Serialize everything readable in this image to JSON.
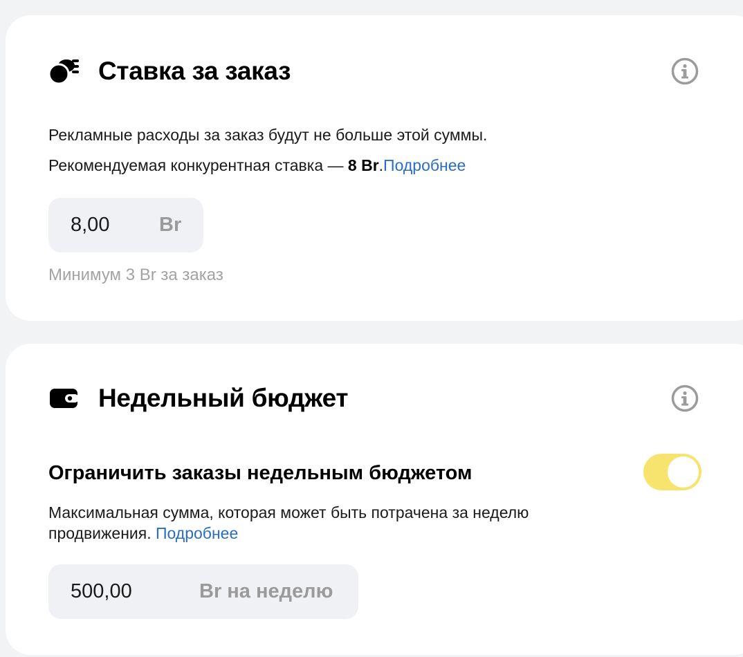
{
  "bid_card": {
    "icon": "coins-icon",
    "title": "Ставка за заказ",
    "info_icon": "info-icon",
    "description": "Рекламные расходы за заказ будут не больше этой суммы.",
    "recommended_prefix": "Рекомендуемая конкурентная ставка — ",
    "recommended_value": "8 Br",
    "recommended_suffix": ".",
    "more_link": "Подробнее",
    "input_value": "8,00",
    "input_unit": "Br",
    "hint": "Минимум 3 Br за заказ"
  },
  "budget_card": {
    "icon": "wallet-icon",
    "title": "Недельный бюджет",
    "info_icon": "info-icon",
    "toggle_label": "Ограничить заказы недельным бюджетом",
    "toggle_on": true,
    "toggle_color": "#f7e46e",
    "description_line1": "Максимальная сумма, которая может быть потрачена за неделю",
    "description_line2": "продвижения.",
    "more_link": "Подробнее",
    "input_value": "500,00",
    "input_unit": "Br на неделю"
  },
  "colors": {
    "background": "#f2f3f5",
    "card": "#ffffff",
    "link": "#2a6dc4",
    "hint": "#a3a3a3",
    "input_bg": "#f0f1f4"
  }
}
